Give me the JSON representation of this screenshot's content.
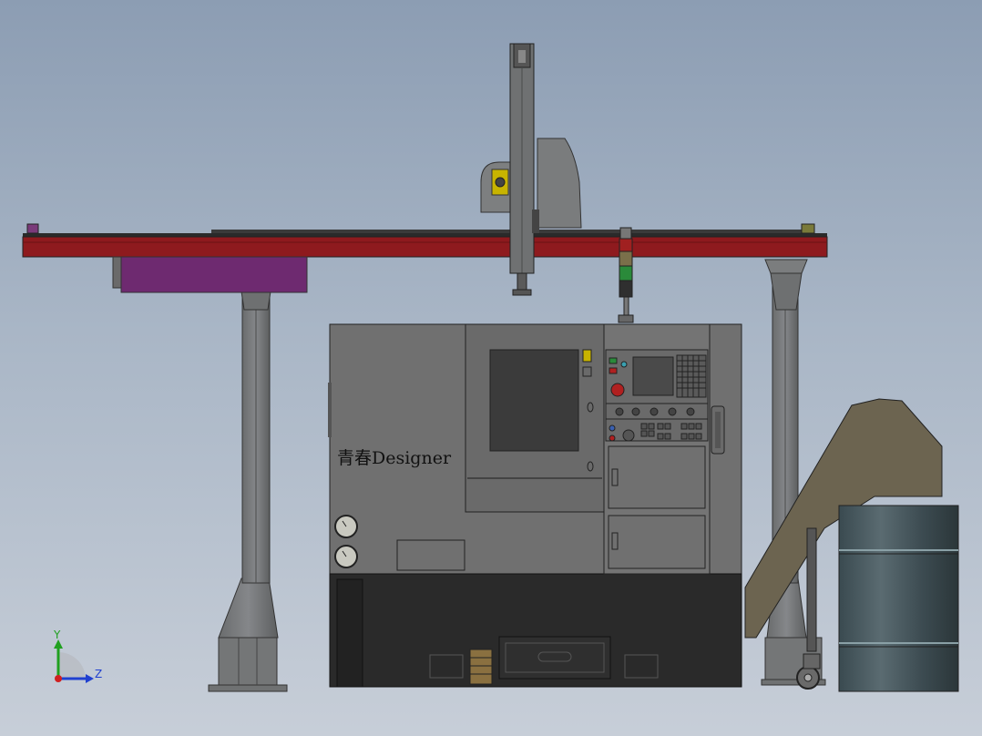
{
  "scene": {
    "watermark": "青春Designer",
    "triad": {
      "y_label": "Y",
      "z_label": "Z"
    }
  },
  "colors": {
    "beam_red": "#8e1a1e",
    "gantry_gray": "#77797a",
    "machine_gray": "#6e6e6e",
    "base_black": "#2a2a2a",
    "conveyor_olive": "#6c6450",
    "drum_teal": "#46555a",
    "purple_box": "#6e2a70",
    "light_green": "#2a8a3a",
    "light_red": "#a02020",
    "y_axis": "#20a020",
    "z_axis": "#2040d0"
  }
}
